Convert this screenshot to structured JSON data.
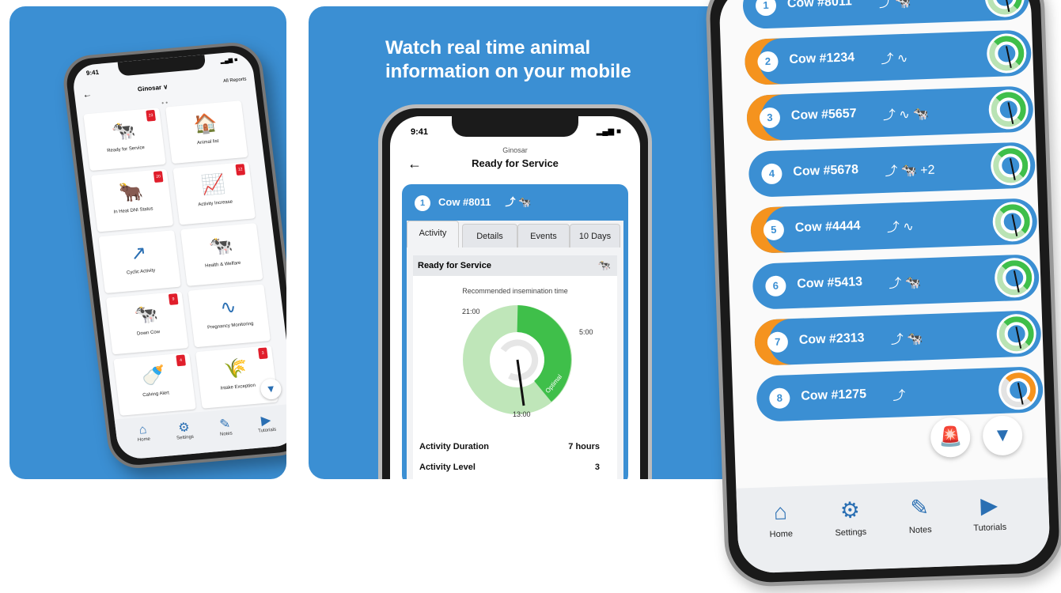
{
  "panel1": {
    "status_time": "9:41",
    "status_right": "▂▄▆ ■",
    "back": "←",
    "farm": "Ginosar ∨",
    "all_reports": "All Reports",
    "page_dots": "• •",
    "tiles": [
      {
        "label": "Ready for Service",
        "icon": "🐄",
        "badge": "23"
      },
      {
        "label": "Animal list",
        "icon": "🏠",
        "badge": ""
      },
      {
        "label": "In Heat DNI Status",
        "icon": "🐂",
        "badge": "20"
      },
      {
        "label": "Activity Increase",
        "icon": "📈",
        "badge": "12"
      },
      {
        "label": "Cyclic Activity",
        "icon": "↗",
        "badge": ""
      },
      {
        "label": "Health & Welfare",
        "icon": "🐄",
        "badge": ""
      },
      {
        "label": "Down Cow",
        "icon": "🐄",
        "badge": "9"
      },
      {
        "label": "Pregnancy Monitoring",
        "icon": "∿",
        "badge": ""
      },
      {
        "label": "Calving Alert",
        "icon": "🍼",
        "badge": "4"
      },
      {
        "label": "Intake Exception",
        "icon": "🌾",
        "badge": "3"
      }
    ],
    "nav": [
      {
        "label": "Home",
        "icon": "⌂"
      },
      {
        "label": "Settings",
        "icon": "⚙"
      },
      {
        "label": "Notes",
        "icon": "✎"
      },
      {
        "label": "Tutorials",
        "icon": "▶"
      }
    ],
    "filter_icon": "▼"
  },
  "panel2": {
    "headline_line1": "Watch real time animal",
    "headline_line2": "information on your mobile",
    "status_time": "9:41",
    "status_right": "▂▄▆ ■",
    "farm": "Ginosar",
    "title": "Ready for Service",
    "back": "←",
    "cow_number": "1",
    "cow_name": "Cow #8011",
    "cow_icons": "⤴ 🐄",
    "tabs": [
      "Activity",
      "Details",
      "Events",
      "10 Days"
    ],
    "section": "Ready for Service",
    "section_icon": "🐄",
    "recommended": "Recommended insemination time",
    "labels": {
      "t1": "21:00",
      "t2": "5:00",
      "t3": "13:00",
      "optimal": "Optimal"
    },
    "stats": [
      {
        "label": "Activity Duration",
        "value": "7 hours"
      },
      {
        "label": "Activity Level",
        "value": "3"
      }
    ]
  },
  "panel3": {
    "cows": [
      {
        "num": "1",
        "name": "Cow #8011",
        "icons": "⤴ 🐄",
        "alert": false,
        "ring": "green"
      },
      {
        "num": "2",
        "name": "Cow #1234",
        "icons": "⤴ ∿",
        "alert": true,
        "ring": "green"
      },
      {
        "num": "3",
        "name": "Cow #5657",
        "icons": "⤴ ∿ 🐄",
        "alert": true,
        "ring": "green"
      },
      {
        "num": "4",
        "name": "Cow #5678",
        "icons": "⤴ 🐄 +2",
        "alert": false,
        "ring": "green"
      },
      {
        "num": "5",
        "name": "Cow #4444",
        "icons": "⤴ ∿",
        "alert": true,
        "ring": "green"
      },
      {
        "num": "6",
        "name": "Cow #5413",
        "icons": "⤴ 🐄",
        "alert": false,
        "ring": "green"
      },
      {
        "num": "7",
        "name": "Cow #2313",
        "icons": "⤴ 🐄",
        "alert": true,
        "ring": "green"
      },
      {
        "num": "8",
        "name": "Cow #1275",
        "icons": "⤴",
        "alert": false,
        "ring": "orange"
      }
    ],
    "alarm_icon": "🚨",
    "filter_icon": "▼",
    "nav": [
      {
        "label": "Home",
        "icon": "⌂"
      },
      {
        "label": "Settings",
        "icon": "⚙"
      },
      {
        "label": "Notes",
        "icon": "✎"
      },
      {
        "label": "Tutorials",
        "icon": "▶"
      }
    ]
  },
  "colors": {
    "brand_blue": "#3b8fd3",
    "alert_orange": "#f5931e",
    "badge_red": "#e01e2b",
    "green": "#3fbf4a"
  }
}
